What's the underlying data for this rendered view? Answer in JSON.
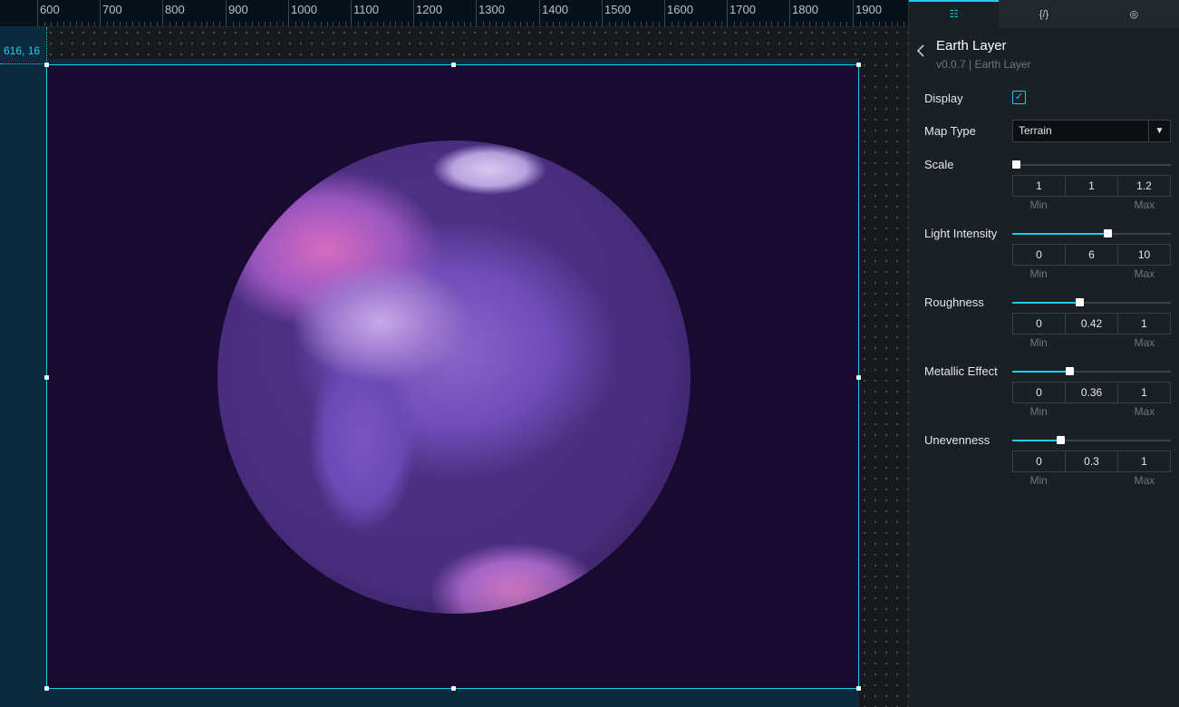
{
  "ruler": {
    "ticks": [
      "600",
      "700",
      "800",
      "900",
      "1000",
      "1100",
      "1200",
      "1300",
      "1400",
      "1500",
      "1600",
      "1700",
      "1800",
      "1900"
    ]
  },
  "canvas": {
    "coordinate": "616, 16"
  },
  "tabs": [
    {
      "label": "☷",
      "icon": "settings-sliders-icon"
    },
    {
      "label": "{/}",
      "icon": "code-braces-icon"
    },
    {
      "label": "◎",
      "icon": "interaction-icon"
    }
  ],
  "layer": {
    "title": "Earth Layer",
    "subtitle": "v0.0.7 | Earth Layer"
  },
  "display": {
    "label": "Display",
    "checked": true
  },
  "map_type": {
    "label": "Map Type",
    "value": "Terrain"
  },
  "sliders": [
    {
      "label": "Scale",
      "min": "1",
      "value": "1",
      "max": "1.2",
      "fraction": 0.0,
      "min_caption": "Min",
      "max_caption": "Max"
    },
    {
      "label": "Light Intensity",
      "min": "0",
      "value": "6",
      "max": "10",
      "fraction": 0.6,
      "min_caption": "Min",
      "max_caption": "Max"
    },
    {
      "label": "Roughness",
      "min": "0",
      "value": "0.42",
      "max": "1",
      "fraction": 0.42,
      "min_caption": "Min",
      "max_caption": "Max"
    },
    {
      "label": "Metallic Effect",
      "min": "0",
      "value": "0.36",
      "max": "1",
      "fraction": 0.36,
      "min_caption": "Min",
      "max_caption": "Max"
    },
    {
      "label": "Unevenness",
      "min": "0",
      "value": "0.3",
      "max": "1",
      "fraction": 0.3,
      "min_caption": "Min",
      "max_caption": "Max"
    }
  ],
  "colors": {
    "accent": "#1ad0e8",
    "stage_background": "#180a30",
    "globe": "#4a2f80"
  }
}
